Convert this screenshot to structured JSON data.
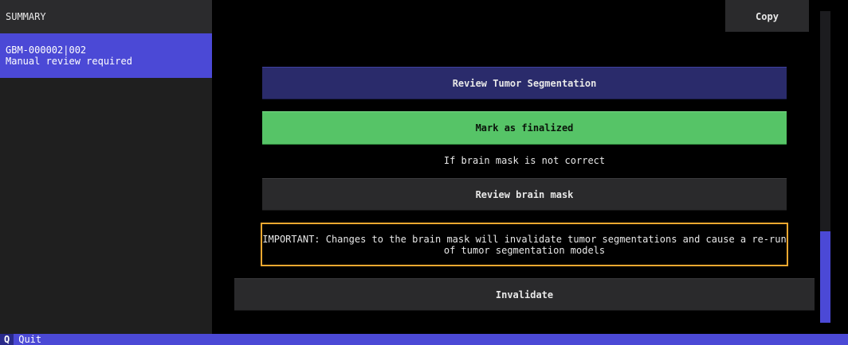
{
  "sidebar": {
    "header": "SUMMARY",
    "items": [
      {
        "line1": "GBM-000002|002",
        "line2": "Manual review required"
      }
    ]
  },
  "main": {
    "copy_label": "Copy",
    "review_tumor_label": "Review Tumor Segmentation",
    "mark_finalized_label": "Mark as finalized",
    "brain_mask_hint": "If brain mask is not correct",
    "review_brain_mask_label": "Review brain mask",
    "warning_text": "IMPORTANT: Changes to the brain mask will invalidate tumor segmentations and cause a re-run of tumor segmentation models",
    "invalidate_label": "Invalidate"
  },
  "footer": {
    "key": "Q",
    "label": "Quit"
  },
  "colors": {
    "accent": "#4b49d6",
    "finalize_green": "#56c467",
    "review_navy": "#2a2b6b",
    "warning_orange": "#f0a830"
  }
}
